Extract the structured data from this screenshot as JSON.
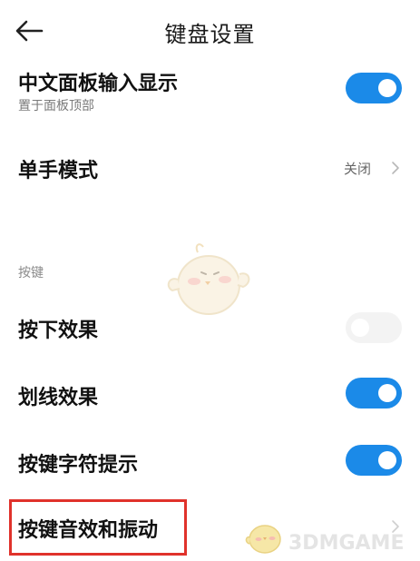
{
  "header": {
    "title": "键盘设置",
    "back_icon": "back-arrow-icon"
  },
  "settings": {
    "chinese_panel": {
      "title": "中文面板输入显示",
      "subtitle": "置于面板顶部",
      "toggle_on": true
    },
    "one_hand": {
      "title": "单手模式",
      "value": "关闭"
    },
    "section_keys": "按键",
    "press_effect": {
      "title": "按下效果",
      "toggle_on": false
    },
    "swipe_effect": {
      "title": "划线效果",
      "toggle_on": true
    },
    "key_char_hint": {
      "title": "按键字符提示",
      "toggle_on": true
    },
    "key_sound_vibration": {
      "title": "按键音效和振动"
    }
  },
  "watermark": {
    "text": "3DMGAME"
  },
  "colors": {
    "accent": "#1b8ae8",
    "highlight_border": "#e0322b"
  }
}
